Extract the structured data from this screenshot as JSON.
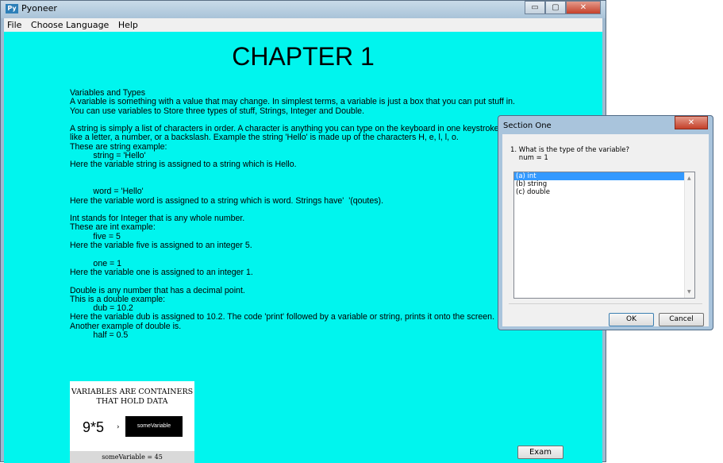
{
  "window": {
    "title": "Pyoneer",
    "icon_name": "python-icon",
    "caption_buttons": {
      "minimize": "▭",
      "maximize": "▢",
      "close": "✕"
    }
  },
  "menu": {
    "items": [
      "File",
      "Choose Language",
      "Help"
    ]
  },
  "content": {
    "background": "#00f5ee",
    "chapter_title": "CHAPTER 1",
    "lines": [
      "Variables and Types",
      "A variable is something with a value that may change. In simplest terms, a variable is just a box that you can put stuff in.",
      "You can use variables to Store three types of stuff, Strings, Integer and Double.",
      "",
      "A string is simply a list of characters in order. A character is anything you can type on the keyboard in one keystroke,",
      "like a letter, a number, or a backslash. Example the string 'Hello' is made up of the characters H, e, l, l, o.",
      "These are string example:",
      "          string = 'Hello'",
      "Here the variable string is assigned to a string which is Hello.",
      "",
      "",
      "          word = 'Hello'",
      "Here the variable word is assigned to a string which is word. Strings have'  '(qoutes).",
      "",
      "Int stands for Integer that is any whole number.",
      "These are int example:",
      "          five = 5",
      "Here the variable five is assigned to an integer 5.",
      "",
      "          one = 1",
      "Here the variable one is assigned to an integer 1.",
      "",
      "Double is any number that has a decimal point.",
      "This is a double example:",
      "          dub = 10.2",
      "Here the variable dub is assigned to 10.2. The code 'print' followed by a variable or string, prints it onto the screen.",
      "Another example of double is.",
      "          half = 0.5"
    ],
    "illustration": {
      "caption": "VARIABLES ARE CONTAINERS\nTHAT HOLD DATA",
      "expression": "9*5",
      "arrow": "›",
      "box_label": "someVariable",
      "footer": "someVariable = 45"
    },
    "exam_button": "Exam"
  },
  "dialog": {
    "title": "Section One",
    "close_symbol": "✕",
    "question": "1. What is the type of the variable?\n    num = 1",
    "options": [
      "(a) int",
      "(b) string",
      "(c) double"
    ],
    "selected_index": 0,
    "ok_label": "OK",
    "cancel_label": "Cancel"
  }
}
